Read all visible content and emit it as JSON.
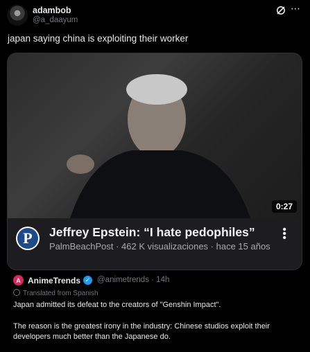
{
  "tweet": {
    "author_name": "adambob",
    "author_handle": "@a_daayum",
    "text": "japan saying china is exploiting their worker"
  },
  "video": {
    "duration": "0:27",
    "title": "Jeffrey Epstein: “I hate pedophiles”",
    "meta": "PalmBeachPost · 462 K visualizaciones · hace 15 años",
    "channel_initial": "P"
  },
  "quoted": {
    "author_name": "AnimeTrends",
    "author_handle": "@animetrends · 14h",
    "translated_label": "Translated from Spanish",
    "text1": "Japan admitted its defeat to the creators of \"Genshin Impact\".",
    "text2": "The reason is the greatest irony in the industry: Chinese studios exploit their developers much better than the Japanese do."
  },
  "icons": {
    "grok": "grok-icon",
    "more": "more-icon",
    "verified": "verified-badge-icon",
    "globe": "globe-icon"
  },
  "colors": {
    "background": "#000000",
    "verified": "#1d9bf0",
    "anime_brand": "#e0245e"
  }
}
